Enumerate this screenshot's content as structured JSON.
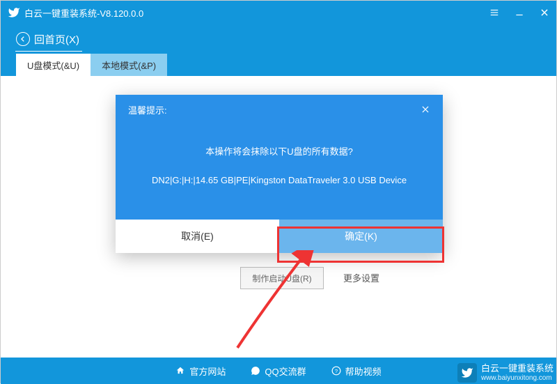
{
  "titlebar": {
    "title": "白云一键重装系统-V8.120.0.0"
  },
  "subheader": {
    "back_label": "回首页(X)"
  },
  "tabs": {
    "items": [
      {
        "label": "U盘模式(&U)",
        "active": true
      },
      {
        "label": "本地模式(&P)",
        "active": false
      }
    ]
  },
  "background": {
    "make_button": "制作启动U盘(R)",
    "more_settings": "更多设置"
  },
  "dialog": {
    "title": "温馨提示:",
    "body_line1": "本操作将会抹除以下U盘的所有数据?",
    "body_line2": "DN2|G:|H:|14.65 GB|PE|Kingston DataTraveler 3.0 USB Device",
    "cancel_label": "取消(E)",
    "confirm_label": "确定(K)"
  },
  "footer": {
    "items": [
      {
        "label": "官方网站"
      },
      {
        "label": "QQ交流群"
      },
      {
        "label": "帮助视频"
      }
    ]
  },
  "watermark": {
    "brand": "白云一键重装系统",
    "url": "www.baiyunxitong.com"
  }
}
